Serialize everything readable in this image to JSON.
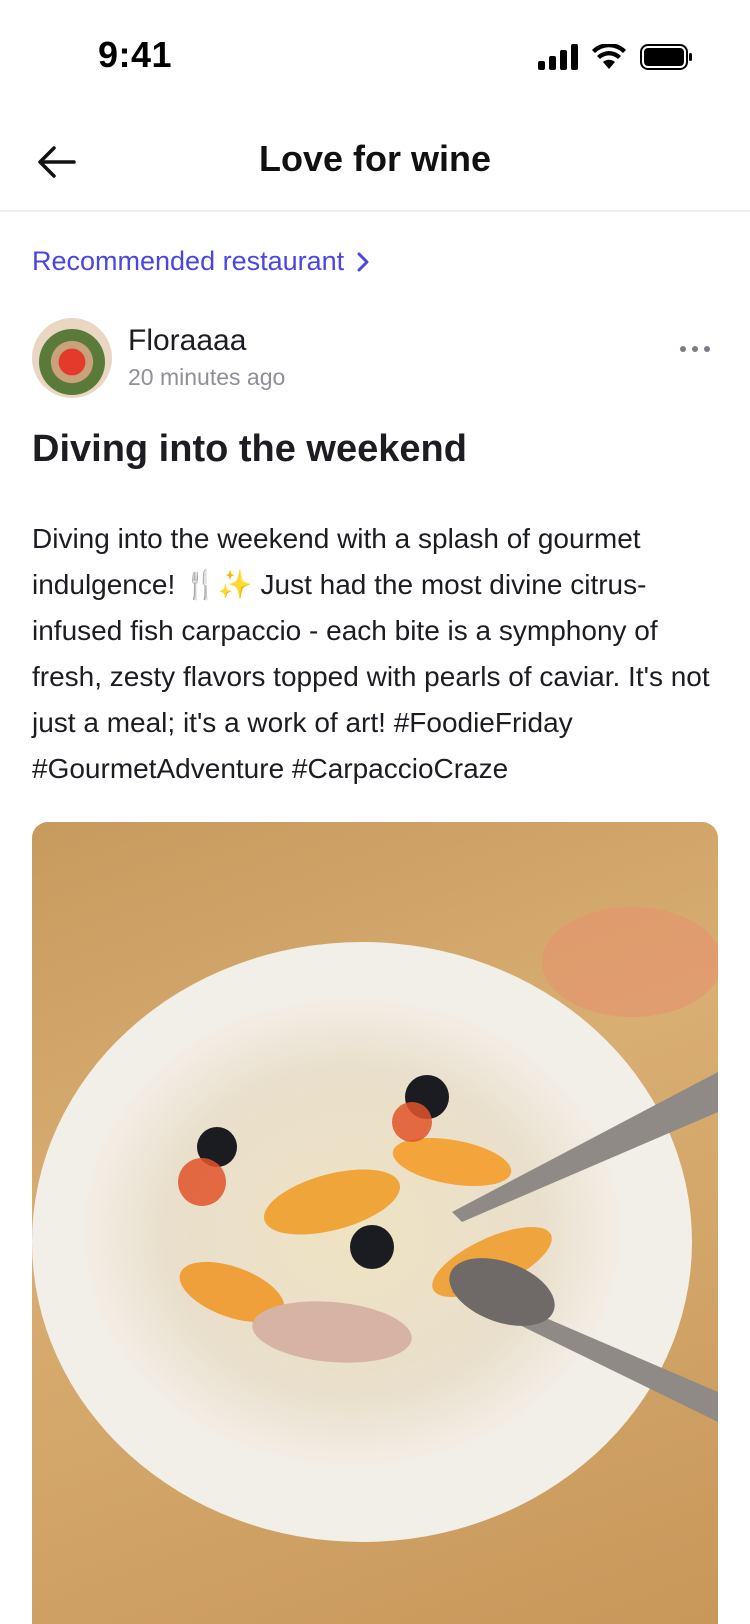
{
  "status_bar": {
    "time": "9:41"
  },
  "header": {
    "title": "Love for wine"
  },
  "recommended": {
    "label": "Recommended restaurant"
  },
  "author": {
    "name": "Floraaaa",
    "time": "20 minutes ago"
  },
  "post": {
    "title": "Diving into the weekend",
    "body": "Diving into the weekend with a splash of gourmet indulgence! 🍴✨ Just had the most divine citrus-infused fish carpaccio - each bite is a symphony of fresh, zesty flavors topped with pearls of caviar. It's not just a meal; it's a work of art! #FoodieFriday #GourmetAdventure #CarpaccioCraze"
  },
  "colors": {
    "accent": "#4a45e6",
    "muted": "#8e8f98",
    "text": "#1c1c22"
  },
  "icons": [
    "signal-icon",
    "wifi-icon",
    "battery-icon",
    "back-arrow-icon",
    "chevron-right-icon",
    "more-icon"
  ]
}
